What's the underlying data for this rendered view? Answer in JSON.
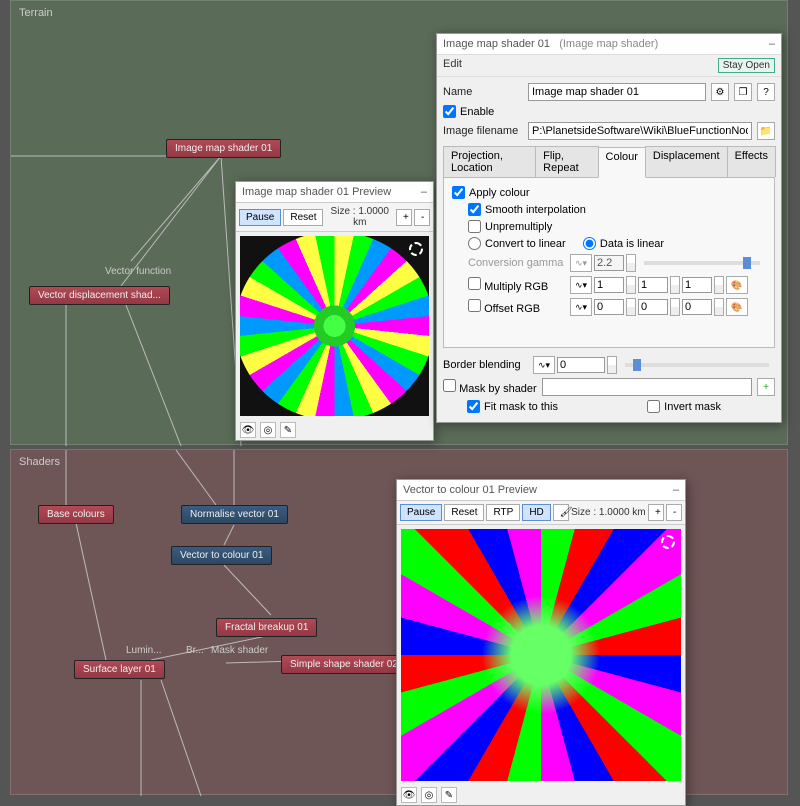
{
  "panels": {
    "terrain": "Terrain",
    "shaders": "Shaders"
  },
  "nodes": {
    "image_map_shader": "Image map shader 01",
    "vector_function": "Vector function",
    "vector_displacement": "Vector displacement shad...",
    "base_colours": "Base colours",
    "normalise_vector": "Normalise vector 01",
    "vector_to_colour": "Vector to colour 01",
    "fractal_breakup": "Fractal breakup 01",
    "lumin": "Lumin...",
    "br": "Br...",
    "mask_shader": "Mask shader",
    "simple_shape": "Simple shape shader 02",
    "surface_layer": "Surface layer 01"
  },
  "preview1": {
    "title": "Image map shader 01 Preview",
    "pause": "Pause",
    "reset": "Reset",
    "size": "Size : 1.0000 km",
    "plus": "+",
    "minus": "-"
  },
  "preview2": {
    "title": "Vector to colour 01 Preview",
    "pause": "Pause",
    "reset": "Reset",
    "rtp": "RTP",
    "hd": "HD",
    "size": "Size : 1.0000 km",
    "plus": "+",
    "minus": "-"
  },
  "props": {
    "title_node": "Image map shader 01",
    "title_type": "(Image map shader)",
    "menu_edit": "Edit",
    "stay_open": "Stay Open",
    "name_label": "Name",
    "name_value": "Image map shader 01",
    "enable": "Enable",
    "filename_label": "Image filename",
    "filename_value": "P:\\PlanetsideSoftware\\Wiki\\BlueFunctionNodes\\Displacem",
    "tabs": [
      "Projection, Location",
      "Flip, Repeat",
      "Colour",
      "Displacement",
      "Effects"
    ],
    "active_tab": "Colour",
    "apply_colour": "Apply colour",
    "smooth_interpolation": "Smooth interpolation",
    "unpremultiply": "Unpremultiply",
    "convert_to_linear": "Convert to linear",
    "data_is_linear": "Data is linear",
    "conversion_gamma": "Conversion gamma",
    "gamma_value": "2.2",
    "multiply_rgb": "Multiply RGB",
    "multiply_values": [
      "1",
      "1",
      "1"
    ],
    "offset_rgb": "Offset RGB",
    "offset_values": [
      "0",
      "0",
      "0"
    ],
    "border_blending": "Border blending",
    "border_value": "0",
    "mask_by_shader": "Mask by shader",
    "fit_mask": "Fit mask to this",
    "invert_mask": "Invert mask"
  }
}
